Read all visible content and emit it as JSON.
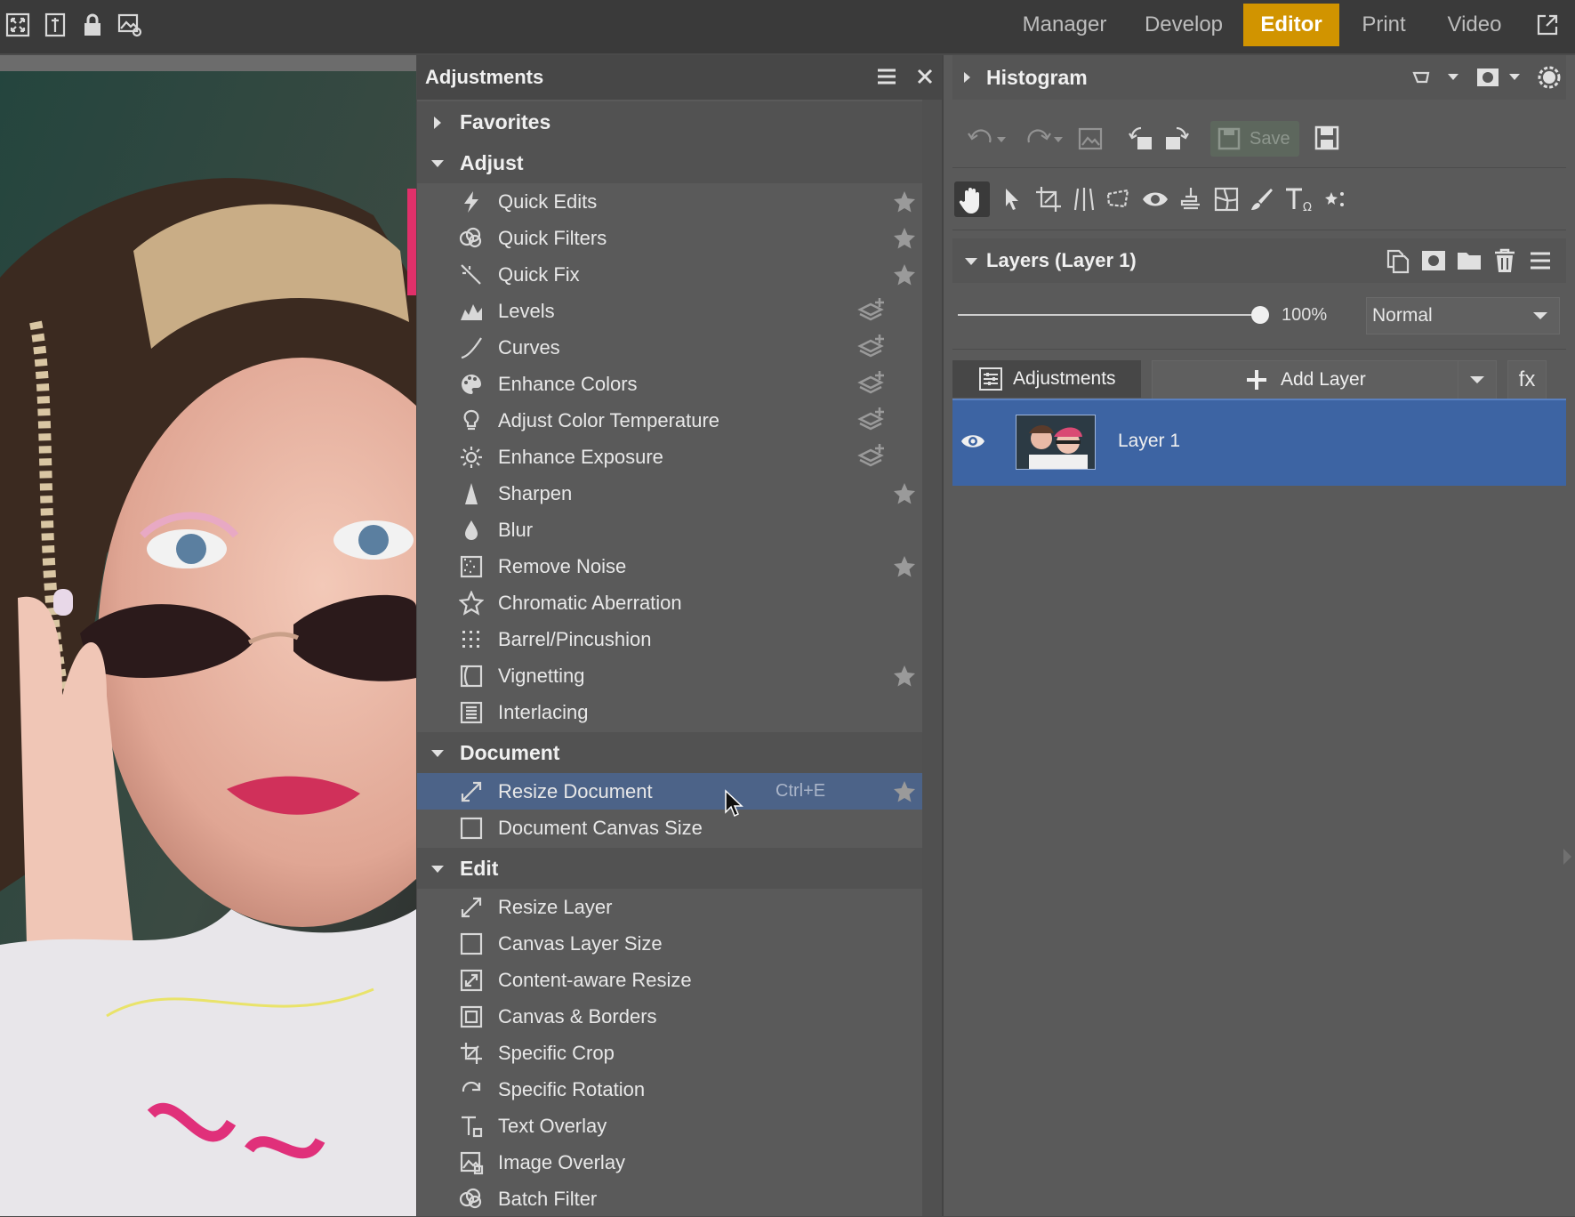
{
  "app": {
    "modules": [
      "Manager",
      "Develop",
      "Editor",
      "Print",
      "Video"
    ],
    "active_module": "Editor"
  },
  "adjustments": {
    "title": "Adjustments",
    "sections": {
      "favorites": "Favorites",
      "adjust": "Adjust",
      "document": "Document",
      "edit": "Edit"
    },
    "adjust_items": [
      {
        "label": "Quick Edits",
        "icon": "lightning-icon",
        "fav": true
      },
      {
        "label": "Quick Filters",
        "icon": "filters-icon",
        "fav": true
      },
      {
        "label": "Quick Fix",
        "icon": "magic-wand-icon",
        "fav": true
      },
      {
        "label": "Levels",
        "icon": "levels-icon",
        "layer": true
      },
      {
        "label": "Curves",
        "icon": "curves-icon",
        "layer": true
      },
      {
        "label": "Enhance Colors",
        "icon": "palette-icon",
        "layer": true
      },
      {
        "label": "Adjust Color Temperature",
        "icon": "bulb-icon",
        "layer": true
      },
      {
        "label": "Enhance Exposure",
        "icon": "sun-icon",
        "layer": true
      },
      {
        "label": "Sharpen",
        "icon": "sharpen-icon",
        "fav": true
      },
      {
        "label": "Blur",
        "icon": "drop-icon"
      },
      {
        "label": "Remove Noise",
        "icon": "noise-icon",
        "fav": true
      },
      {
        "label": "Chromatic Aberration",
        "icon": "star-outline-icon"
      },
      {
        "label": "Barrel/Pincushion",
        "icon": "grid-dots-icon"
      },
      {
        "label": "Vignetting",
        "icon": "vignette-icon",
        "fav": true
      },
      {
        "label": "Interlacing",
        "icon": "interlace-icon"
      }
    ],
    "document_items": [
      {
        "label": "Resize Document",
        "icon": "resize-icon",
        "shortcut": "Ctrl+E",
        "fav": true
      },
      {
        "label": "Document Canvas Size",
        "icon": "square-icon"
      }
    ],
    "edit_items": [
      {
        "label": "Resize Layer",
        "icon": "resize-icon"
      },
      {
        "label": "Canvas Layer Size",
        "icon": "square-icon"
      },
      {
        "label": "Content-aware Resize",
        "icon": "content-aware-icon"
      },
      {
        "label": "Canvas & Borders",
        "icon": "borders-icon"
      },
      {
        "label": "Specific Crop",
        "icon": "crop-icon"
      },
      {
        "label": "Specific Rotation",
        "icon": "rotate-icon"
      },
      {
        "label": "Text Overlay",
        "icon": "text-icon"
      },
      {
        "label": "Image Overlay",
        "icon": "image-overlay-icon"
      },
      {
        "label": "Batch Filter",
        "icon": "filters-icon"
      }
    ]
  },
  "right_panel": {
    "histogram_title": "Histogram",
    "save_label": "Save",
    "layers_title": "Layers (Layer 1)",
    "opacity": "100%",
    "opacity_fraction": 1.0,
    "blend_mode": "Normal",
    "adjustments_button": "Adjustments",
    "add_layer_button": "Add Layer",
    "fx_button": "fx",
    "layers": [
      {
        "name": "Layer 1",
        "visible": true,
        "selected": true
      }
    ]
  },
  "colors": {
    "accent": "#d19400",
    "selection": "#3d64a3",
    "hover_row": "#4c6388"
  }
}
